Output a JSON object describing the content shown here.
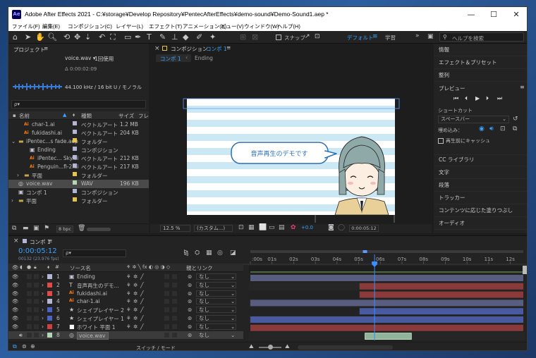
{
  "window": {
    "title": "Adobe After Effects 2021 - C:¥storage¥Develop Repository¥PentecAfterEffects¥demo-sound¥Demo-Sound1.aep *",
    "app_icon": "Ae",
    "min": "—",
    "max": "☐",
    "close": "✕"
  },
  "menu": [
    "ファイル(F)",
    "編集(E)",
    "コンポジション(C)",
    "レイヤー(L)",
    "エフェクト(T)",
    "アニメーション(A)",
    "ビュー(V)",
    "ウィンドウ(W)",
    "ヘルプ(H)"
  ],
  "toolbar": {
    "snap_label": "スナップ",
    "workspace": "デフォルト",
    "learn": "学習",
    "search_placeholder": "ヘルプを検索"
  },
  "project": {
    "title": "プロジェクト",
    "menu_icon": "≡",
    "preview_name": "voice.wav ▾",
    "usage": "1回使用",
    "duration": "Δ 0:00:02:09",
    "audio_info": "44.100 kHz / 16 bit U / モノラル",
    "search_icon": "ρ▾",
    "columns": [
      "名前",
      "種類",
      "サイズ",
      "フレ"
    ],
    "items": [
      {
        "name": "char-1.ai",
        "type": "ベクトルアート",
        "size": "1.2 MB",
        "indent": 1,
        "icon": "ai",
        "color": "#b5b5d6"
      },
      {
        "name": "fukidashi.ai",
        "type": "ベクトルアート",
        "size": "204 KB",
        "indent": 1,
        "icon": "ai",
        "color": "#b5b5d6"
      },
      {
        "name": "iPentec...s fade.aep",
        "type": "フォルダー",
        "size": "",
        "indent": 0,
        "icon": "folder",
        "color": "#e3c54a",
        "expanded": true
      },
      {
        "name": "Ending",
        "type": "コンポジション",
        "size": "",
        "indent": 2,
        "icon": "comp",
        "color": "#b5b5d6"
      },
      {
        "name": "iPentec... Sky.ai",
        "type": "ベクトルアート",
        "size": "212 KB",
        "indent": 2,
        "icon": "ai",
        "color": "#b5b5d6"
      },
      {
        "name": "Penguin...fi-2.ai",
        "type": "ベクトルアート",
        "size": "217 KB",
        "indent": 2,
        "icon": "ai",
        "color": "#b5b5d6"
      },
      {
        "name": "平面",
        "type": "フォルダー",
        "size": "",
        "indent": 1,
        "icon": "folder",
        "color": "#e3c54a",
        "expanded": false
      },
      {
        "name": "voice.wav",
        "type": "WAV",
        "size": "196 KB",
        "indent": 0,
        "icon": "wav",
        "color": "#b5d6b5",
        "selected": true
      },
      {
        "name": "コンポ 1",
        "type": "コンポジション",
        "size": "",
        "indent": 0,
        "icon": "comp",
        "color": "#b5b5d6"
      },
      {
        "name": "平面",
        "type": "フォルダー",
        "size": "",
        "indent": 0,
        "icon": "folder",
        "color": "#e3c54a",
        "expanded": false
      }
    ],
    "bpc": "8 bpc"
  },
  "composition": {
    "title_prefix": "コンポジション",
    "title_name": "コンポ 1",
    "menu_icon": "≡",
    "crumbs": [
      "コンポ 1",
      "Ending"
    ],
    "speech_text": "音声再生のデモです",
    "zoom": "12.5 %",
    "res": "(カスタム...)",
    "exposure": "+0.0",
    "timecode": "0:00:05:12"
  },
  "right": {
    "items": [
      "情報",
      "エフェクト＆プリセット",
      "整列"
    ],
    "preview_title": "プレビュー",
    "shortcut_label": "ショートカット",
    "shortcut_value": "スペースバー",
    "include_label": "埋め込み：",
    "cache_label": "再生前にキャッシュ",
    "lower": [
      "CC ライブラリ",
      "文字",
      "段落",
      "トラッカー",
      "コンテンツに応じた塗りつぶし",
      "オーディオ"
    ]
  },
  "timeline": {
    "tab": "コンポ 1",
    "menu_icon": "≡",
    "timecode": "0:00:05:12",
    "fps": "00132 (23.976 fps)",
    "search_placeholder": "ρ▾",
    "col_source": "ソース名",
    "col_parent": "親とリンク",
    "layers": [
      {
        "n": "1",
        "name": "Ending",
        "icon": "comp",
        "color": "#b5b5d6",
        "parent": "なし",
        "bar_start": 0.0,
        "bar_end": 1.0,
        "bar_color": "#595e80"
      },
      {
        "n": "2",
        "name": "音声再生のデモ...",
        "icon": "T",
        "color": "#e04a4a",
        "parent": "なし",
        "bar_start": 0.4,
        "bar_end": 1.0,
        "bar_color": "#8a3a3a"
      },
      {
        "n": "3",
        "name": "fukidashi.ai",
        "icon": "ai",
        "color": "#e04a4a",
        "parent": "なし",
        "bar_start": 0.4,
        "bar_end": 1.0,
        "bar_color": "#8a3a3a"
      },
      {
        "n": "4",
        "name": "char-1.ai",
        "icon": "ai",
        "color": "#b5b5d6",
        "parent": "なし",
        "bar_start": 0.0,
        "bar_end": 1.0,
        "bar_color": "#595e80"
      },
      {
        "n": "5",
        "name": "シェイプレイヤー 2",
        "icon": "star",
        "color": "#4a63c7",
        "parent": "なし",
        "bar_start": 0.4,
        "bar_end": 1.0,
        "bar_color": "#4a5aa0"
      },
      {
        "n": "6",
        "name": "シェイプレイヤー 1",
        "icon": "star",
        "color": "#4a63c7",
        "parent": "なし",
        "bar_start": 0.0,
        "bar_end": 1.0,
        "bar_color": "#4a5aa0"
      },
      {
        "n": "7",
        "name": "ホワイト 平面 1",
        "icon": "solid",
        "color": "#d04040",
        "parent": "なし",
        "bar_start": 0.0,
        "bar_end": 1.0,
        "bar_color": "#8a3a3a"
      },
      {
        "n": "8",
        "name": "voice.wav",
        "icon": "wav",
        "color": "#b5d6b5",
        "parent": "なし",
        "bar_start": 0.42,
        "bar_end": 0.59,
        "bar_color": "#8fb59a",
        "selected": true
      }
    ],
    "ruler": [
      ":00s",
      "01s",
      "02s",
      "03s",
      "04s",
      "05s",
      "06s",
      "07s",
      "08s",
      "09s",
      "10s",
      "11s",
      "12s"
    ],
    "playhead": 0.455,
    "switch_mode": "スイッチ / モード"
  }
}
